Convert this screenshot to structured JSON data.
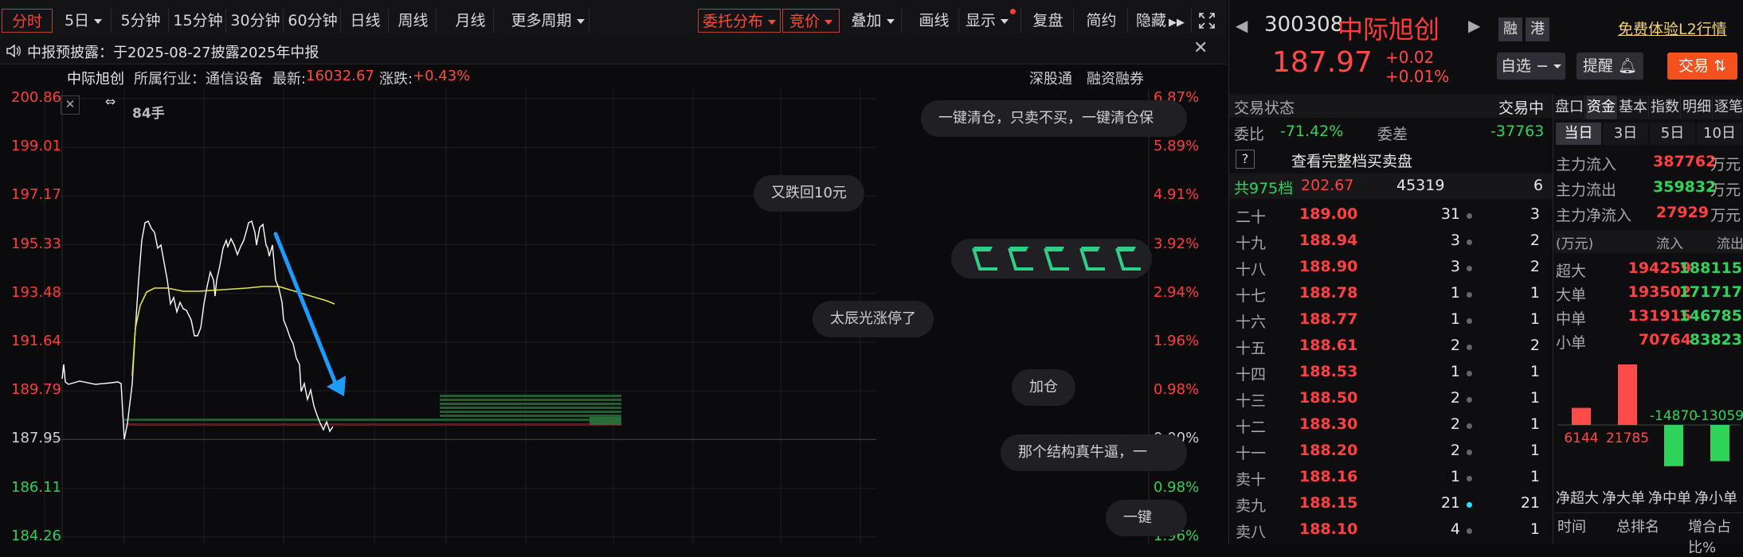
{
  "toolbar": {
    "fenshi": "分时",
    "day5": "5日",
    "min5": "5分钟",
    "min15": "15分钟",
    "min30": "30分钟",
    "min60": "60分钟",
    "dayk": "日线",
    "weekk": "周线",
    "monthk": "月线",
    "more": "更多周期",
    "weituo": "委托分布",
    "jingjia": "竞价",
    "diejia": "叠加",
    "huaxian": "画线",
    "xianshi": "显示",
    "fupan": "复盘",
    "jianyue": "简约",
    "yincang": "隐藏"
  },
  "notice": {
    "text": "中报预披露：于2025-08-27披露2025年中报"
  },
  "infobar": {
    "name": "中际旭创",
    "industry": "所属行业：通信设备",
    "latest_label": "最新:",
    "latest": "16032.67",
    "change_label": "涨跌:",
    "change": "+0.43%",
    "sgt": "深股通",
    "rzrq": "融资融券"
  },
  "chart": {
    "volume_label": "84手",
    "left_axis": [
      "200.86",
      "199.01",
      "197.17",
      "195.33",
      "193.48",
      "191.64",
      "189.79",
      "187.95",
      "186.11",
      "184.26"
    ],
    "right_axis": [
      "6.87%",
      "5.89%",
      "4.91%",
      "3.92%",
      "2.94%",
      "1.96%",
      "0.98%",
      "0.00%",
      "0.98%",
      "1.96%"
    ],
    "bubbles": [
      "一键清仓，只卖不买，一键清仓保",
      "又跌回10元",
      "太辰光涨停了",
      "加仓",
      "那个结构真牛逼，一",
      "一键"
    ],
    "colors": {
      "price": "#ffffff",
      "avg": "#e5e24a",
      "arrow": "#1e9bff",
      "up": "#ff3b3b",
      "down": "#2ecf5a"
    }
  },
  "quote": {
    "code": "300308",
    "name": "中际旭创",
    "tag_rong": "融",
    "tag_gang": "港",
    "l2": "免费体验L2行情",
    "price": "187.97",
    "chg": "+0.02",
    "chg_pct": "+0.01%",
    "zixuan": "自选",
    "tixing": "提醒",
    "jiaoyi": "交易"
  },
  "trade_status": {
    "label": "交易状态",
    "value": "交易中",
    "weibi_label": "委比",
    "weibi": "-71.42%",
    "weicha_label": "委差",
    "weicha": "-37763"
  },
  "full_book": {
    "q": "?",
    "text": "查看完整档买卖盘"
  },
  "levels_summary": {
    "label": "共975档",
    "price": "202.67",
    "vol": "45319",
    "num": "6"
  },
  "sell_levels": [
    {
      "n": "二十",
      "p": "189.00",
      "v": "31",
      "c": "3"
    },
    {
      "n": "十九",
      "p": "188.94",
      "v": "3",
      "c": "2"
    },
    {
      "n": "十八",
      "p": "188.90",
      "v": "3",
      "c": "2"
    },
    {
      "n": "十七",
      "p": "188.78",
      "v": "1",
      "c": "1"
    },
    {
      "n": "十六",
      "p": "188.77",
      "v": "1",
      "c": "1"
    },
    {
      "n": "十五",
      "p": "188.61",
      "v": "2",
      "c": "2"
    },
    {
      "n": "十四",
      "p": "188.53",
      "v": "1",
      "c": "1"
    },
    {
      "n": "十三",
      "p": "188.50",
      "v": "2",
      "c": "1"
    },
    {
      "n": "十二",
      "p": "188.30",
      "v": "2",
      "c": "1"
    },
    {
      "n": "十一",
      "p": "188.20",
      "v": "2",
      "c": "1"
    },
    {
      "n": "卖十",
      "p": "188.16",
      "v": "1",
      "c": "1"
    },
    {
      "n": "卖九",
      "p": "188.15",
      "v": "21",
      "c": "21"
    },
    {
      "n": "卖八",
      "p": "188.10",
      "v": "4",
      "c": "1"
    }
  ],
  "fund_tabs": [
    "盘口",
    "资金",
    "基本",
    "指数",
    "明细",
    "逐笔"
  ],
  "period_tabs": [
    "当日",
    "3日",
    "5日",
    "10日"
  ],
  "fund_flow": [
    {
      "label": "主力流入",
      "value": "387762",
      "unit": "万元"
    },
    {
      "label": "主力流出",
      "value": "359832",
      "unit": "万元"
    },
    {
      "label": "主力净流入",
      "value": "27929",
      "unit": "万元"
    }
  ],
  "fund_table": {
    "headers": [
      "(万元)",
      "流入",
      "流出"
    ],
    "rows": [
      {
        "label": "超大",
        "in": "194259",
        "out": "188115"
      },
      {
        "label": "大单",
        "in": "193502",
        "out": "171717"
      },
      {
        "label": "中单",
        "in": "131915",
        "out": "146785"
      },
      {
        "label": "小单",
        "in": "70764",
        "out": "83823"
      }
    ]
  },
  "net_chart": {
    "categories": [
      "净超大",
      "净大单",
      "净中单",
      "净小单"
    ],
    "values": [
      6144,
      21785,
      -14870,
      -13059
    ],
    "labels": [
      "6144",
      "21785",
      "-14870",
      "-13059"
    ]
  },
  "bottom_headers": [
    "时间",
    "总排名",
    "增合占比%"
  ]
}
